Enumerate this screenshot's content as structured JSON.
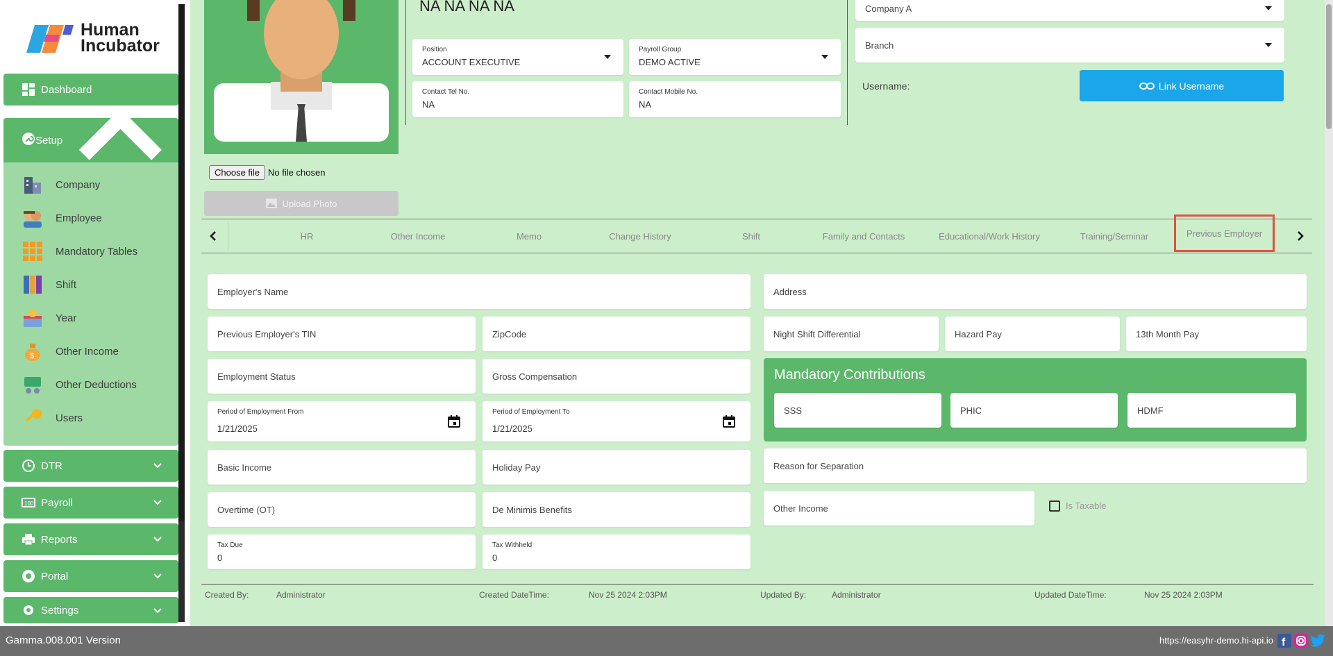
{
  "brand": {
    "name_line1": "Human",
    "name_line2": "Incubator"
  },
  "sidebar": {
    "dashboard": "Dashboard",
    "setup": "Setup",
    "setup_items": [
      "Company",
      "Employee",
      "Mandatory Tables",
      "Shift",
      "Year",
      "Other Income",
      "Other Deductions",
      "Users"
    ],
    "dtr": "DTR",
    "payroll": "Payroll",
    "reports": "Reports",
    "portal": "Portal",
    "settings": "Settings"
  },
  "profile": {
    "name": "NA NA  NA NA",
    "choose_file": "Choose file",
    "no_file": "No file chosen",
    "upload_photo": "Upload Photo",
    "position_label": "Position",
    "position_value": "ACCOUNT EXECUTIVE",
    "payroll_group_label": "Payroll Group",
    "payroll_group_value": "DEMO ACTIVE",
    "contact_tel_label": "Contact Tel No.",
    "contact_tel_value": "NA",
    "contact_mobile_label": "Contact Mobile No.",
    "contact_mobile_value": "NA",
    "company_value": "Company A",
    "branch_placeholder": "Branch",
    "username_label": "Username:",
    "link_username": "Link Username"
  },
  "tabs": [
    "HR",
    "Other Income",
    "Memo",
    "Change History",
    "Shift",
    "Family and Contacts",
    "Educational/Work History",
    "Training/Seminar",
    "Previous Employer"
  ],
  "active_tab": "Previous Employer",
  "form": {
    "employer_name": "Employer's Name",
    "address": "Address",
    "prev_tin": "Previous Employer's TIN",
    "zipcode": "ZipCode",
    "night_shift": "Night Shift Differential",
    "hazard_pay": "Hazard Pay",
    "thirteenth": "13th Month Pay",
    "employment_status": "Employment Status",
    "gross_comp": "Gross Compensation",
    "mandatory_title": "Mandatory Contributions",
    "sss": "SSS",
    "phic": "PHIC",
    "hdmf": "HDMF",
    "period_from_label": "Period of Employment From",
    "period_from_value": "1/21/2025",
    "period_to_label": "Period of Employment To",
    "period_to_value": "1/21/2025",
    "basic_income": "Basic Income",
    "holiday_pay": "Holiday Pay",
    "reason_sep": "Reason for Separation",
    "overtime": "Overtime (OT)",
    "de_minimis": "De Minimis Benefits",
    "other_income": "Other Income",
    "is_taxable": "Is Taxable",
    "tax_due_label": "Tax Due",
    "tax_due_value": "0",
    "tax_withheld_label": "Tax Withheld",
    "tax_withheld_value": "0"
  },
  "meta": {
    "created_by_label": "Created By:",
    "created_by": "Administrator",
    "created_dt_label": "Created DateTime:",
    "created_dt": "Nov 25 2024 2:03PM",
    "updated_by_label": "Updated By:",
    "updated_by": "Administrator",
    "updated_dt_label": "Updated DateTime:",
    "updated_dt": "Nov 25 2024 2:03PM"
  },
  "footer": {
    "version": "Gamma.008.001 Version",
    "url": "https://easyhr-demo.hi-api.io"
  },
  "colors": {
    "green": "#5bb86a",
    "light_green": "#cdeecb",
    "blue": "#1aa6e8",
    "highlight": "#e0523e"
  }
}
